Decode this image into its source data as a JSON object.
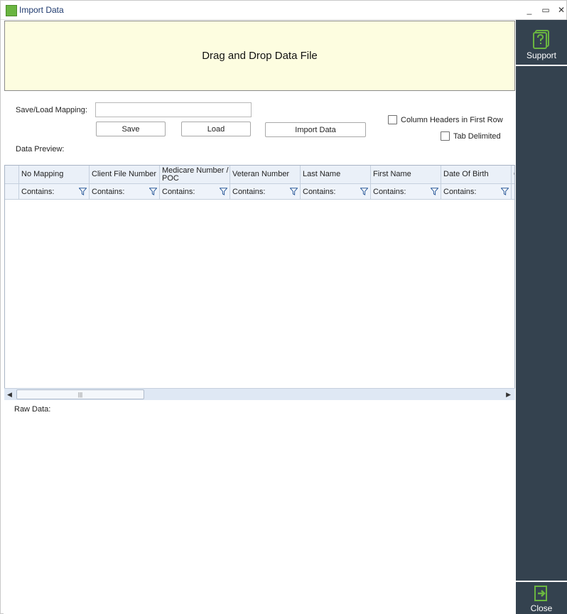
{
  "window": {
    "title": "Import Data",
    "min_glyph": "_",
    "max_glyph": "▭",
    "close_glyph": "✕"
  },
  "dropzone": {
    "text": "Drag and Drop Data File"
  },
  "mapping": {
    "label": "Save/Load Mapping:",
    "value": "",
    "save_label": "Save",
    "load_label": "Load"
  },
  "import_button": {
    "label": "Import Data"
  },
  "options": {
    "column_headers": {
      "label": "Column Headers in First Row",
      "checked": false
    },
    "tab_delimited": {
      "label": "Tab Delimited",
      "checked": false
    }
  },
  "preview": {
    "label": "Data Preview:",
    "columns": [
      "No Mapping",
      "Client File Number",
      "Medicare Number / POC",
      "Veteran Number",
      "Last Name",
      "First Name",
      "Date Of Birth",
      "C"
    ],
    "filter_label": "Contains:",
    "thumb_grip": "|||",
    "scroll_left_glyph": "◀",
    "scroll_right_glyph": "▶"
  },
  "raw": {
    "label": "Raw Data:"
  },
  "sidebar": {
    "support_label": "Support",
    "close_label": "Close"
  },
  "colors": {
    "sidebar_bg": "#34424f",
    "accent_green": "#6ab540",
    "dropzone_bg": "#fdfde0"
  }
}
